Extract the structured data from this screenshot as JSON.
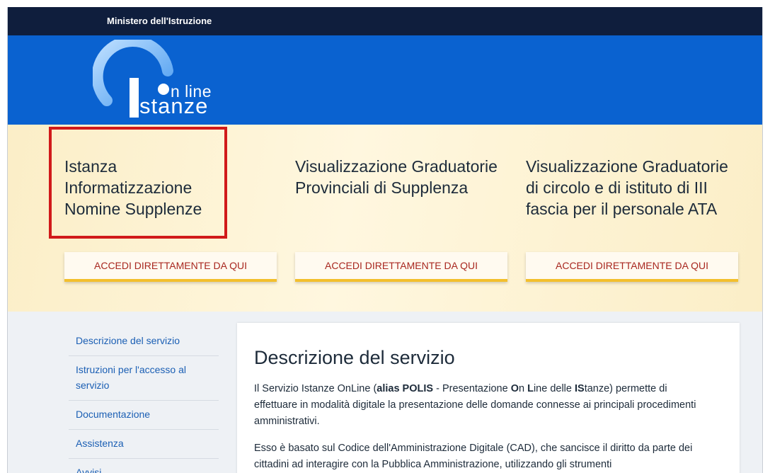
{
  "header": {
    "ministry": "Ministero dell'Istruzione"
  },
  "logo": {
    "line1": "n line",
    "line2": "stanze"
  },
  "hero": {
    "cards": [
      {
        "title": "Istanza Informatizzazione Nomine Supplenze",
        "button": "ACCEDI DIRETTAMENTE DA QUI"
      },
      {
        "title": "Visualizzazione Graduatorie Provinciali di Supplenza",
        "button": "ACCEDI DIRETTAMENTE DA QUI"
      },
      {
        "title": "Visualizzazione Graduatorie di circolo e di istituto di III fascia per il personale ATA",
        "button": "ACCEDI DIRETTAMENTE DA QUI"
      }
    ]
  },
  "sidebar": {
    "items": [
      {
        "label": "Descrizione del servizio"
      },
      {
        "label": "Istruzioni per l'accesso al servizio"
      },
      {
        "label": "Documentazione"
      },
      {
        "label": "Assistenza"
      },
      {
        "label": "Avvisi"
      }
    ]
  },
  "main": {
    "title": "Descrizione del servizio",
    "p1_a": "Il Servizio Istanze OnLine (",
    "p1_b": "alias POLIS",
    "p1_c": " - Presentazione ",
    "p1_d": "O",
    "p1_e": "n ",
    "p1_f": "L",
    "p1_g": "ine delle ",
    "p1_h": "IS",
    "p1_i": "tanze) permette di effettuare in modalità digitale la presentazione delle domande connesse ai principali procedimenti amministrativi.",
    "p2": "Esso è basato sul Codice dell'Amministrazione Digitale (CAD), che sancisce il diritto da parte dei cittadini ad interagire con la Pubblica Amministrazione, utilizzando gli strumenti"
  },
  "colors": {
    "topbar": "#0f1e3d",
    "brand_blue": "#0a62d0",
    "button_text": "#a8271f",
    "button_accent": "#f3bf2c",
    "highlight": "#d11a1a",
    "link": "#1b5fb4"
  }
}
